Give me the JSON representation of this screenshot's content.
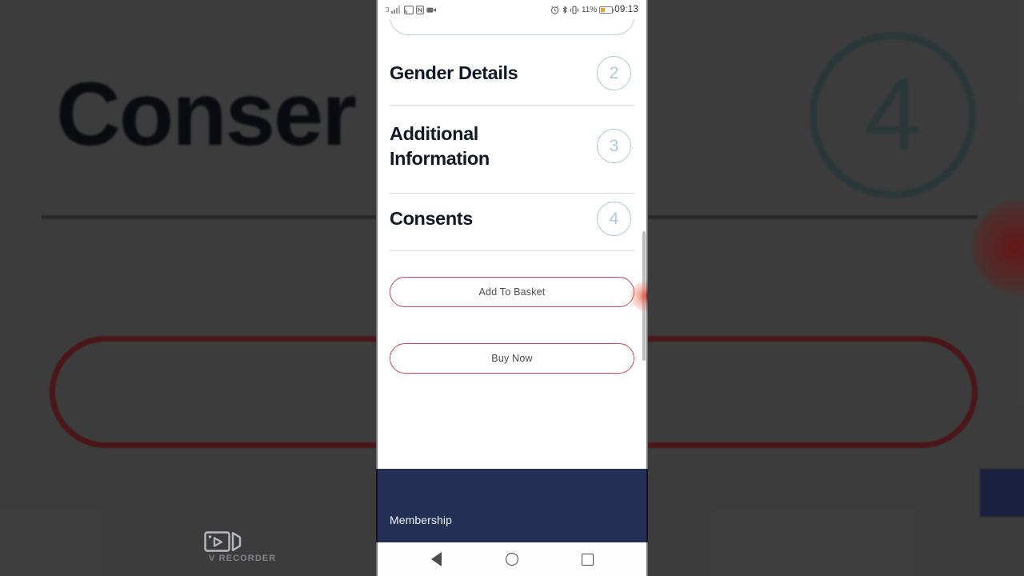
{
  "background": {
    "title_fragment": "Conser",
    "step_badge": "4",
    "description": "blurred zoomed-out view of the same Consents form"
  },
  "statusbar": {
    "network_gen": "3",
    "icons_left": [
      "signal-icon",
      "wifi-cast-icon",
      "nfc-icon",
      "screen-record-icon"
    ],
    "icons_right": [
      "alarm-icon",
      "bluetooth-icon",
      "vibrate-icon"
    ],
    "battery_percent": "11%",
    "time": "09:13"
  },
  "accordion": {
    "items": [
      {
        "label": "Gender Details",
        "step": "2"
      },
      {
        "label": "Additional Information",
        "step": "3"
      },
      {
        "label": "Consents",
        "step": "4"
      }
    ]
  },
  "actions": {
    "add_to_basket": "Add To Basket",
    "buy_now": "Buy Now"
  },
  "footer": {
    "label": "Membership"
  },
  "navbar": {
    "back": "back-button",
    "home": "home-button",
    "recents": "recents-button"
  },
  "watermark": {
    "text": "V RECORDER"
  },
  "colors": {
    "accent_red": "#cf4350",
    "step_circle": "#a9ccd5",
    "footer_navy": "#242f55",
    "heading_text": "#111827",
    "background_grey": "#575757"
  }
}
